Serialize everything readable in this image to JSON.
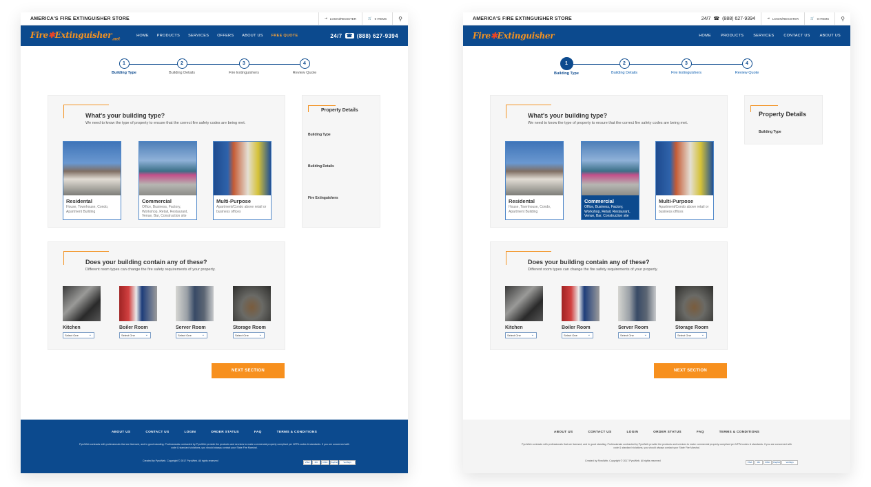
{
  "store_name": "AMERICA'S FIRE EXTINGUISHER STORE",
  "phone_top": "(888) 627-9394",
  "phone_prefix": "24/7",
  "login_label": "LOGIN/REGISTER",
  "cart_label": "0 ITEMS",
  "logo": {
    "fire": "Fire",
    "ext": "Extinguisher",
    "tld": ".net"
  },
  "nav_v1": [
    "HOME",
    "PRODUCTS",
    "SERVICES",
    "OFFERS",
    "ABOUT US",
    "FREE QUOTE"
  ],
  "nav_v2": [
    "HOME",
    "PRODUCTS",
    "SERVICES",
    "CONTACT US",
    "ABOUT US"
  ],
  "nav_phone": "24/7  (888) 627-9394",
  "steps": [
    {
      "num": "1",
      "label": "Building Type"
    },
    {
      "num": "2",
      "label": "Building Details"
    },
    {
      "num": "3",
      "label": "Fire Extinguishers"
    },
    {
      "num": "4",
      "label": "Review Quote"
    }
  ],
  "building": {
    "title": "What's your building type?",
    "subtitle": "We need to know the type of property to ensure that the correct fire safety codes are being met.",
    "options": [
      {
        "name": "Residental",
        "desc": "House, Townhouse, Condo, Apartment Building"
      },
      {
        "name": "Commercial",
        "desc": "Office, Business, Factory, Workshop, Retail, Restaurant, Venue, Bar, Construction site"
      },
      {
        "name": "Multi-Purpose",
        "desc": "Apartment/Condo above retail or business offices"
      }
    ]
  },
  "rooms": {
    "title": "Does your building contain any of these?",
    "subtitle": "Different room types can change the fire safety requirements of your property.",
    "select_placeholder": "Select One",
    "items": [
      {
        "name": "Kitchen"
      },
      {
        "name": "Boiler Room"
      },
      {
        "name": "Server Room"
      },
      {
        "name": "Storage Room"
      }
    ]
  },
  "next_label": "NEXT SECTION",
  "property": {
    "title": "Property Details",
    "items": [
      "Building Type",
      "Building Details",
      "Fire Extinguishers"
    ]
  },
  "footer": {
    "links": [
      "ABOUT US",
      "CONTACT US",
      "LOGIN",
      "ORDER STATUS",
      "FAQ",
      "TERMS & CONDITIONS"
    ],
    "text": "PyroWeb contracts with professionals that are licensed, and in good standing. Professionals contracted by PyroWeb provide the products and services to make commercial property compliant per NFPA codes & standards. If you are concerned with code & standard violations, you should always contact your State Fire Marshal.",
    "copyright": "Created by PyroWeb. Copyright © 2017 PyroWeb. All rights reserved",
    "cards": [
      "VISA",
      "MC",
      "DISC",
      "PayPal",
      "VeriSign"
    ]
  }
}
